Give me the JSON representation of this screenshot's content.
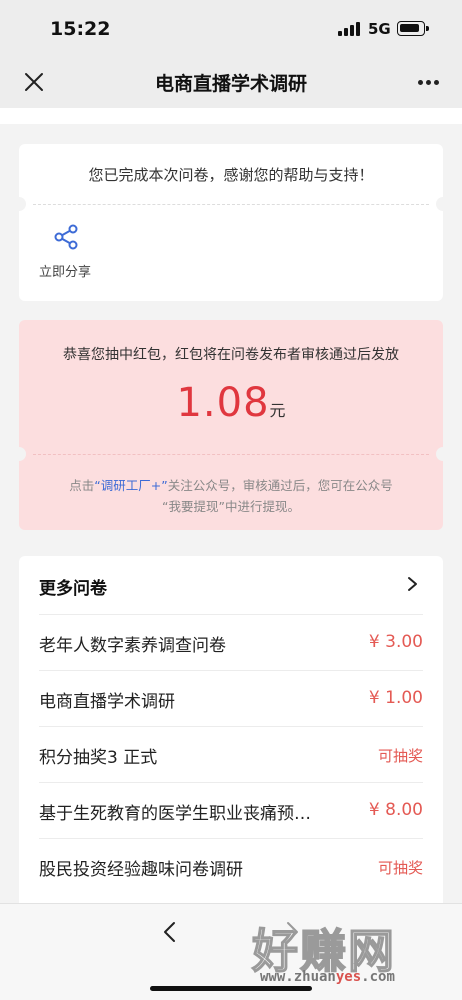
{
  "status": {
    "time": "15:22",
    "network": "5G"
  },
  "nav": {
    "title": "电商直播学术调研"
  },
  "thanks": {
    "message": "您已完成本次问卷，感谢您的帮助与支持！",
    "share_label": "立即分享"
  },
  "red_packet": {
    "title": "恭喜您抽中红包，红包将在问卷发布者审核通过后发放",
    "amount": "1.08",
    "unit": "元",
    "note_prefix": "点击",
    "note_link": "“调研工厂+”",
    "note_suffix": "关注公众号，审核通过后，您可在公众号",
    "note_line2": "“我要提现”中进行提现。"
  },
  "more": {
    "title": "更多问卷",
    "items": [
      {
        "title": "老年人数字素养调查问卷",
        "value": "¥ 3.00"
      },
      {
        "title": "电商直播学术调研",
        "value": "¥ 1.00"
      },
      {
        "title": "积分抽奖3 正式",
        "value": "可抽奖"
      },
      {
        "title": "基于生死教育的医学生职业丧痛预…",
        "value": "¥ 8.00"
      },
      {
        "title": "股民投资经验趣味问卷调研",
        "value": "可抽奖"
      }
    ]
  },
  "watermark": {
    "main": "好赚网",
    "sub_pre": "www.zhuan",
    "sub_hl": "yes",
    "sub_post": ".com"
  },
  "colors": {
    "accent_red": "#e0373f",
    "link_blue": "#3d6bd6",
    "card_pink": "#fcdedf"
  },
  "icons": [
    "close-icon",
    "more-dots-icon",
    "share-icon",
    "chevron-right-icon",
    "back-arrow-icon",
    "forward-arrow-icon",
    "signal-icon",
    "battery-icon"
  ]
}
